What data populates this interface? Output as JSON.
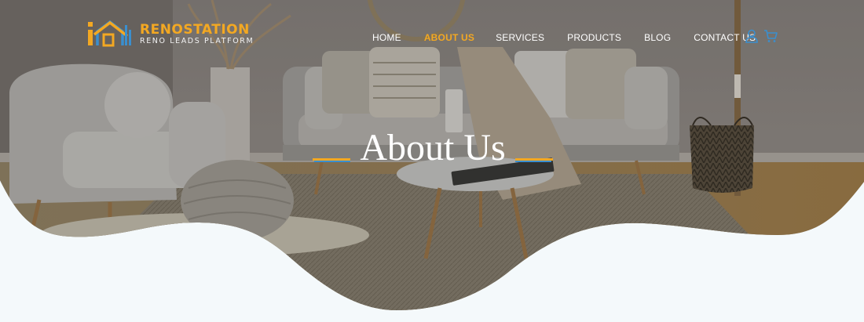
{
  "brand": {
    "name": "RENOSTATION",
    "tagline": "RENO LEADS PLATFORM",
    "logo_icon": "house-logo-icon"
  },
  "nav": {
    "items": [
      {
        "label": "HOME",
        "active": false
      },
      {
        "label": "ABOUT US",
        "active": true
      },
      {
        "label": "SERVICES",
        "active": false
      },
      {
        "label": "PRODUCTS",
        "active": false
      },
      {
        "label": "BLOG",
        "active": false
      },
      {
        "label": "CONTACT US",
        "active": false
      }
    ]
  },
  "header_icons": {
    "account": "user-icon",
    "cart": "cart-icon"
  },
  "hero": {
    "title": "About Us",
    "background": "living-room-photo"
  },
  "colors": {
    "accent": "#f3a822",
    "secondary": "#3a8fcf",
    "page_bg": "#f4f9fb",
    "nav_text": "#ffffff"
  }
}
